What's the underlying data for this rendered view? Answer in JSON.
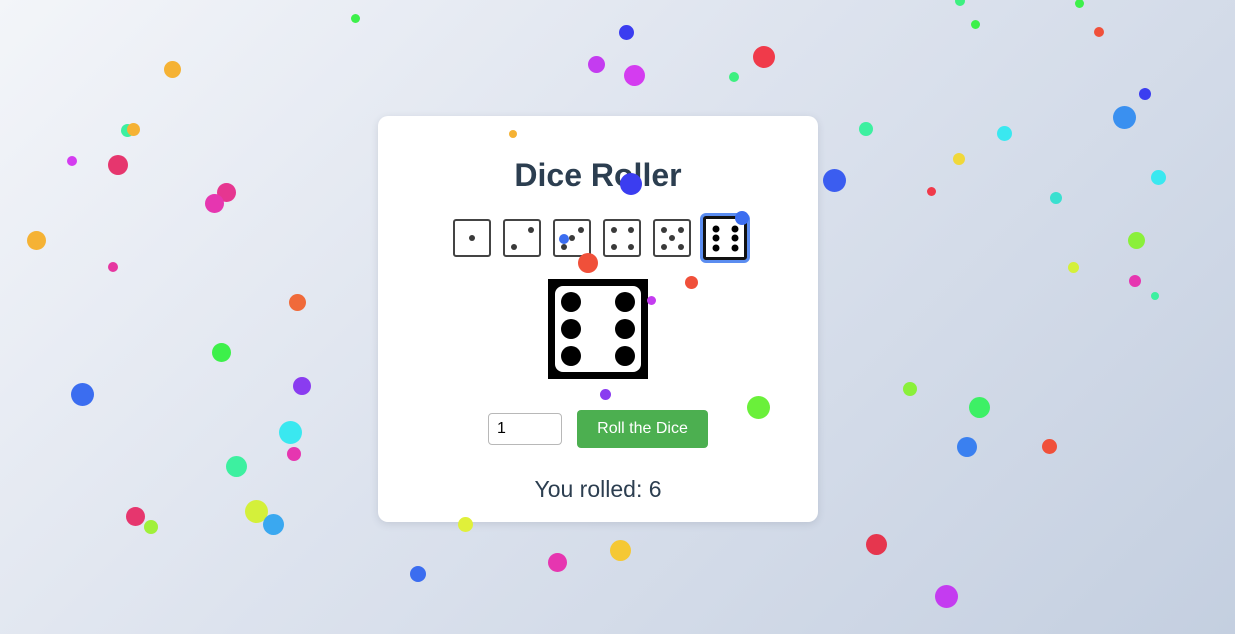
{
  "app": {
    "title": "Dice Roller",
    "roll_button_label": "Roll the Dice",
    "dice_count_value": "1",
    "result_text": "You rolled: 6"
  },
  "history": [
    {
      "value": 1,
      "selected": false
    },
    {
      "value": 2,
      "selected": false
    },
    {
      "value": 3,
      "selected": false
    },
    {
      "value": 4,
      "selected": false
    },
    {
      "value": 5,
      "selected": false
    },
    {
      "value": 6,
      "selected": true
    }
  ],
  "current_die": {
    "value": 6
  },
  "colors": {
    "button": "#4caf50",
    "title_text": "#2c3e50",
    "selected_ring": "#5b8df0",
    "confetti_palette": [
      "#f5b234",
      "#e6366e",
      "#3b6df0",
      "#3df065",
      "#8a3cf0",
      "#f06a3a",
      "#d43cf0",
      "#3df0c8",
      "#3ad0f0",
      "#d4f03a",
      "#f0d03a"
    ]
  }
}
